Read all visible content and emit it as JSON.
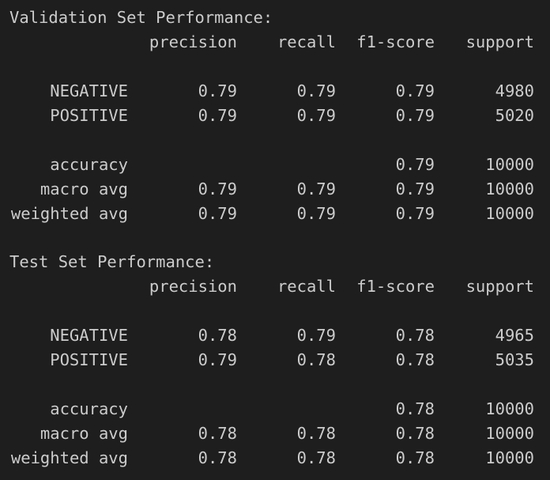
{
  "blocks": [
    {
      "title": "Validation Set Performance:",
      "headers": [
        "precision",
        "recall",
        "f1-score",
        "support"
      ],
      "rows": [
        {
          "label": "NEGATIVE",
          "precision": "0.79",
          "recall": "0.79",
          "f1": "0.79",
          "support": "4980"
        },
        {
          "label": "POSITIVE",
          "precision": "0.79",
          "recall": "0.79",
          "f1": "0.79",
          "support": "5020"
        }
      ],
      "summary": [
        {
          "label": "accuracy",
          "precision": "",
          "recall": "",
          "f1": "0.79",
          "support": "10000"
        },
        {
          "label": "macro avg",
          "precision": "0.79",
          "recall": "0.79",
          "f1": "0.79",
          "support": "10000"
        },
        {
          "label": "weighted avg",
          "precision": "0.79",
          "recall": "0.79",
          "f1": "0.79",
          "support": "10000"
        }
      ]
    },
    {
      "title": "Test Set Performance:",
      "headers": [
        "precision",
        "recall",
        "f1-score",
        "support"
      ],
      "rows": [
        {
          "label": "NEGATIVE",
          "precision": "0.78",
          "recall": "0.79",
          "f1": "0.78",
          "support": "4965"
        },
        {
          "label": "POSITIVE",
          "precision": "0.79",
          "recall": "0.78",
          "f1": "0.78",
          "support": "5035"
        }
      ],
      "summary": [
        {
          "label": "accuracy",
          "precision": "",
          "recall": "",
          "f1": "0.78",
          "support": "10000"
        },
        {
          "label": "macro avg",
          "precision": "0.78",
          "recall": "0.78",
          "f1": "0.78",
          "support": "10000"
        },
        {
          "label": "weighted avg",
          "precision": "0.78",
          "recall": "0.78",
          "f1": "0.78",
          "support": "10000"
        }
      ]
    }
  ],
  "colors": {
    "background": "#1e1e1e",
    "text": "#cccccc"
  }
}
